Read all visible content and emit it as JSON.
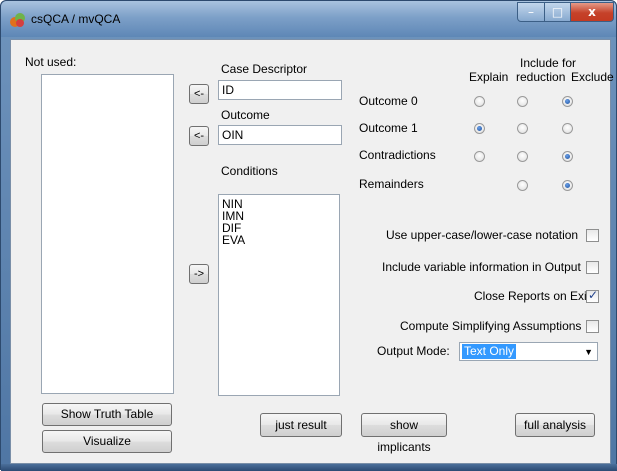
{
  "window": {
    "title": "csQCA / mvQCA",
    "minimize_glyph": "–",
    "maximize_glyph": "□",
    "close_glyph": "x"
  },
  "left_panel": {
    "not_used_label": "Not used:",
    "show_truth_table_label": "Show Truth Table",
    "visualize_label": "Visualize"
  },
  "arrows": {
    "case_descriptor_arrow": "<-",
    "outcome_arrow": "<-",
    "conditions_arrow": "->"
  },
  "middle_panel": {
    "case_descriptor_label": "Case Descriptor",
    "case_descriptor_value": "ID",
    "outcome_label": "Outcome",
    "outcome_value": "OIN",
    "conditions_label": "Conditions",
    "conditions": [
      "NIN",
      "IMN",
      "DIF",
      "EVA"
    ],
    "just_result_label": "just result"
  },
  "outcome_table": {
    "header_explain": "Explain",
    "header_include_1": "Include for",
    "header_include_2": "reduction",
    "header_exclude": "Exclude",
    "rows": [
      {
        "label": "Outcome 0",
        "explain": false,
        "include": false,
        "exclude": true
      },
      {
        "label": "Outcome 1",
        "explain": true,
        "include": false,
        "exclude": false
      },
      {
        "label": "Contradictions",
        "explain": false,
        "include": false,
        "exclude": true
      },
      {
        "label": "Remainders",
        "explain": null,
        "include": false,
        "exclude": true
      }
    ]
  },
  "options": {
    "upper_lower_label": "Use upper-case/lower-case notation",
    "upper_lower_checked": false,
    "include_var_info_label": "Include variable information in Output",
    "include_var_info_checked": false,
    "close_reports_label": "Close Reports on Exit",
    "close_reports_checked": true,
    "compute_simplifying_label": "Compute Simplifying Assumptions",
    "compute_simplifying_checked": false,
    "output_mode_label": "Output Mode:",
    "output_mode_value": "Text Only"
  },
  "bottom_buttons": {
    "show_implicants_label": "show implicants",
    "full_analysis_label": "full analysis"
  },
  "colors": {
    "titlebar": "#7da0c8",
    "close_button": "#c5422a",
    "selection": "#3399ff",
    "dialog_bg": "#f0f0f0"
  }
}
